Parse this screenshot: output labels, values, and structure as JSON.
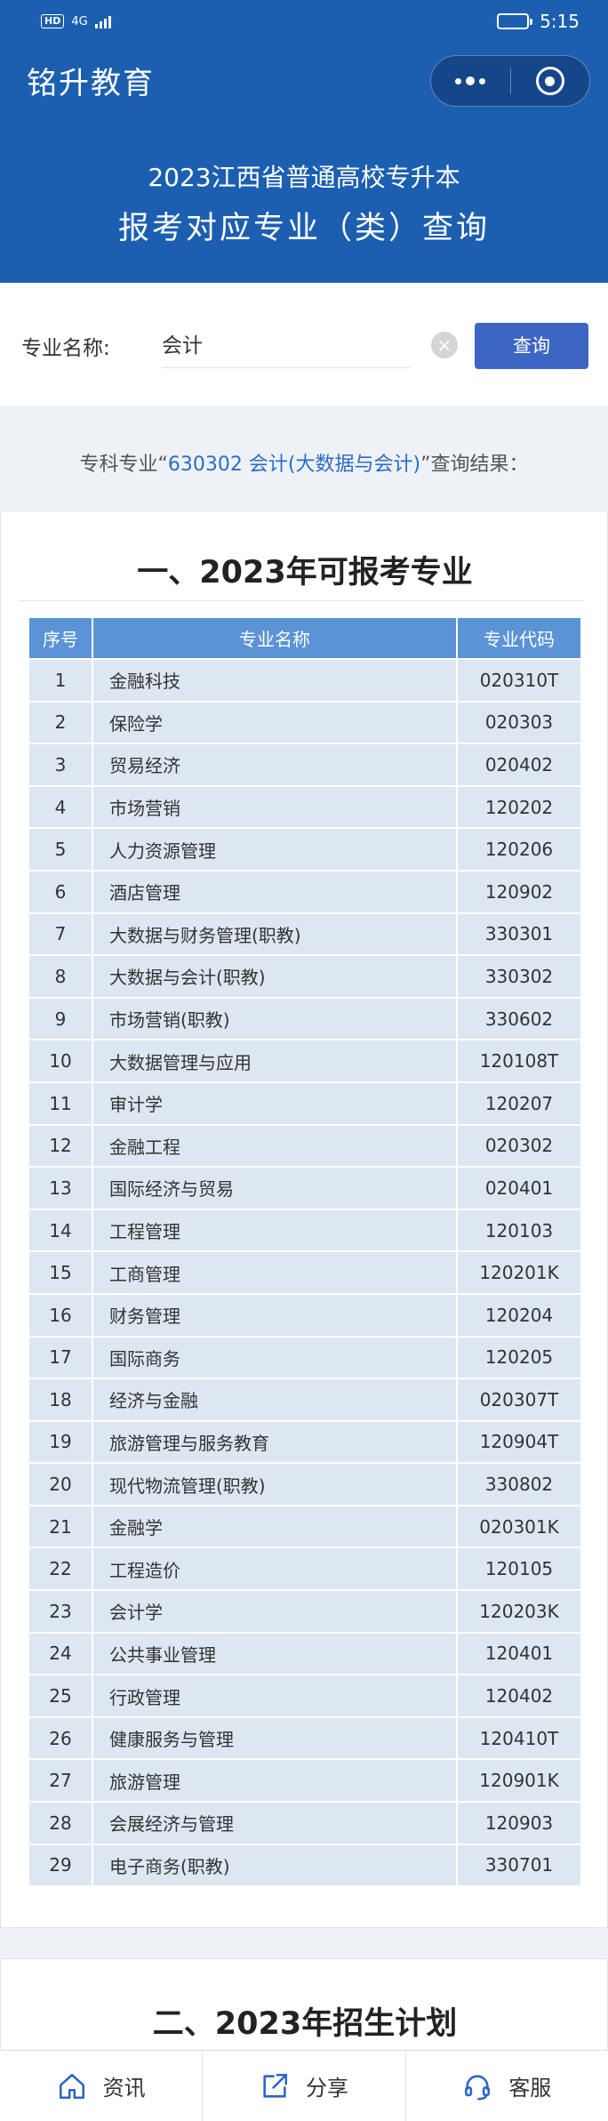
{
  "status_bar": {
    "hd": "HD",
    "net": "4G",
    "time": "5:15"
  },
  "app": {
    "title": "铭升教育"
  },
  "header": {
    "line1": "2023江西省普通高校专升本",
    "line2": "报考对应专业（类）查询"
  },
  "search": {
    "label": "专业名称:",
    "value": "会计",
    "clear_icon": "×",
    "button": "查询"
  },
  "result": {
    "prefix": "专科专业“",
    "code": "630302 会计(大数据与会计)",
    "suffix": "”查询结果："
  },
  "section1": {
    "title": "一、2023年可报考专业",
    "headers": [
      "序号",
      "专业名称",
      "专业代码"
    ],
    "rows": [
      [
        "1",
        "金融科技",
        "020310T"
      ],
      [
        "2",
        "保险学",
        "020303"
      ],
      [
        "3",
        "贸易经济",
        "020402"
      ],
      [
        "4",
        "市场营销",
        "120202"
      ],
      [
        "5",
        "人力资源管理",
        "120206"
      ],
      [
        "6",
        "酒店管理",
        "120902"
      ],
      [
        "7",
        "大数据与财务管理(职教)",
        "330301"
      ],
      [
        "8",
        "大数据与会计(职教)",
        "330302"
      ],
      [
        "9",
        "市场营销(职教)",
        "330602"
      ],
      [
        "10",
        "大数据管理与应用",
        "120108T"
      ],
      [
        "11",
        "审计学",
        "120207"
      ],
      [
        "12",
        "金融工程",
        "020302"
      ],
      [
        "13",
        "国际经济与贸易",
        "020401"
      ],
      [
        "14",
        "工程管理",
        "120103"
      ],
      [
        "15",
        "工商管理",
        "120201K"
      ],
      [
        "16",
        "财务管理",
        "120204"
      ],
      [
        "17",
        "国际商务",
        "120205"
      ],
      [
        "18",
        "经济与金融",
        "020307T"
      ],
      [
        "19",
        "旅游管理与服务教育",
        "120904T"
      ],
      [
        "20",
        "现代物流管理(职教)",
        "330802"
      ],
      [
        "21",
        "金融学",
        "020301K"
      ],
      [
        "22",
        "工程造价",
        "120105"
      ],
      [
        "23",
        "会计学",
        "120203K"
      ],
      [
        "24",
        "公共事业管理",
        "120401"
      ],
      [
        "25",
        "行政管理",
        "120402"
      ],
      [
        "26",
        "健康服务与管理",
        "120410T"
      ],
      [
        "27",
        "旅游管理",
        "120901K"
      ],
      [
        "28",
        "会展经济与管理",
        "120903"
      ],
      [
        "29",
        "电子商务(职教)",
        "330701"
      ]
    ]
  },
  "section2": {
    "title": "二、2023年招生计划"
  },
  "tabbar": {
    "items": [
      {
        "label": "资讯",
        "icon": "home-icon"
      },
      {
        "label": "分享",
        "icon": "share-icon"
      },
      {
        "label": "客服",
        "icon": "headset-icon"
      }
    ]
  },
  "colors": {
    "brand": "#1c5fb0",
    "button": "#3d65c4",
    "table_header": "#5b93d6",
    "table_cell": "#dde7f1"
  }
}
